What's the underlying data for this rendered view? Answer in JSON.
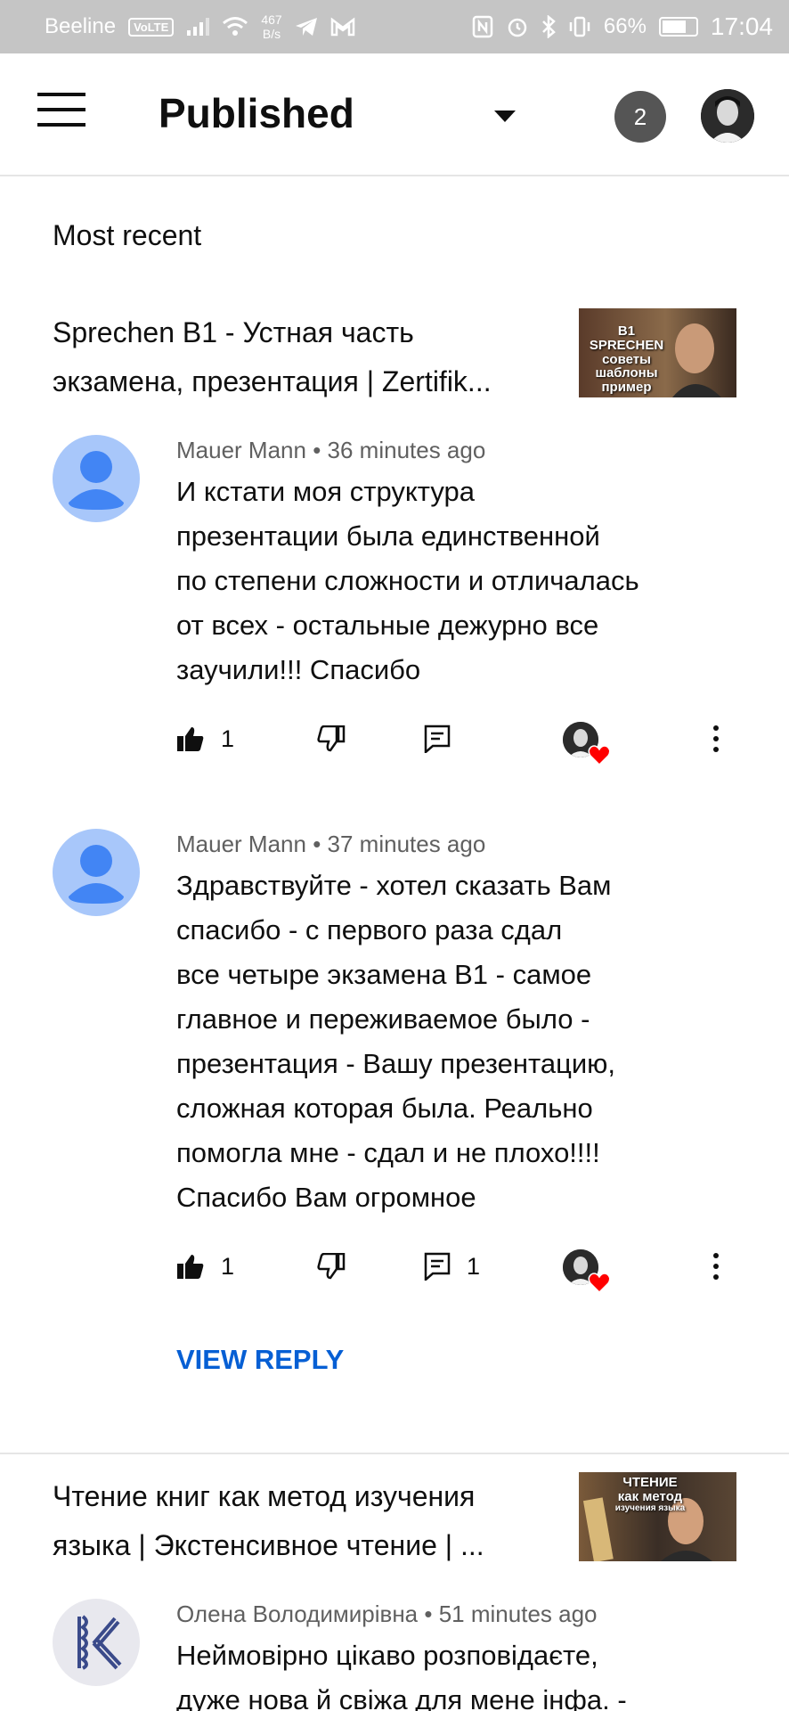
{
  "status_bar": {
    "carrier": "Beeline",
    "volte": "VoLTE",
    "speed_value": "467",
    "speed_unit": "B/s",
    "battery": "66%",
    "time": "17:04"
  },
  "header": {
    "title": "Published",
    "notification_count": "2",
    "icons": [
      "menu-icon",
      "chevron-down-icon",
      "avatar"
    ]
  },
  "filter_label": "Most recent",
  "videos": [
    {
      "title": "Sprechen B1 - Устная часть экзамена, презентация | Zertifik...",
      "thumb_lines": [
        "B1 SPRECHEN",
        "советы",
        "шаблоны",
        "пример"
      ],
      "comments": [
        {
          "author": "Mauer Mann",
          "time": "36 minutes ago",
          "text": "И кстати моя структура\nпрезентации была единственной\nпо степени сложности и отличалась\nот всех - остальные дежурно все\nзаучили!!! Спасибо",
          "likes": "1",
          "replies": ""
        },
        {
          "author": "Mauer Mann",
          "time": "37 minutes ago",
          "text": "Здравствуйте - хотел сказать Вам\nспасибо - с первого раза сдал\nвсе четыре экзамена В1 - самое\nглавное и переживаемое было -\nпрезентация - Вашу презентацию,\nсложная которая была. Реально\nпомогла мне - сдал и не плохо!!!!\nСпасибо Вам огромное",
          "likes": "1",
          "replies": "1",
          "view_reply": "VIEW REPLY"
        }
      ]
    },
    {
      "title": "Чтение книг как метод изучения языка | Экстенсивное чтение | ...",
      "thumb_lines": [
        "ЧТЕНИЕ",
        "как метод",
        "изучения языка"
      ],
      "comments": [
        {
          "author": "Олена Володимирівна",
          "time": "51 minutes ago",
          "text": "Неймовірно цікаво розповідаєте,\nдуже нова й свіжа для мене інфа. -"
        }
      ]
    }
  ],
  "colors": {
    "status_bar_bg": "#c5c5c5",
    "link_blue": "#065fd4",
    "default_avatar": "#a8c7fa",
    "heart_red": "#ff0000"
  }
}
